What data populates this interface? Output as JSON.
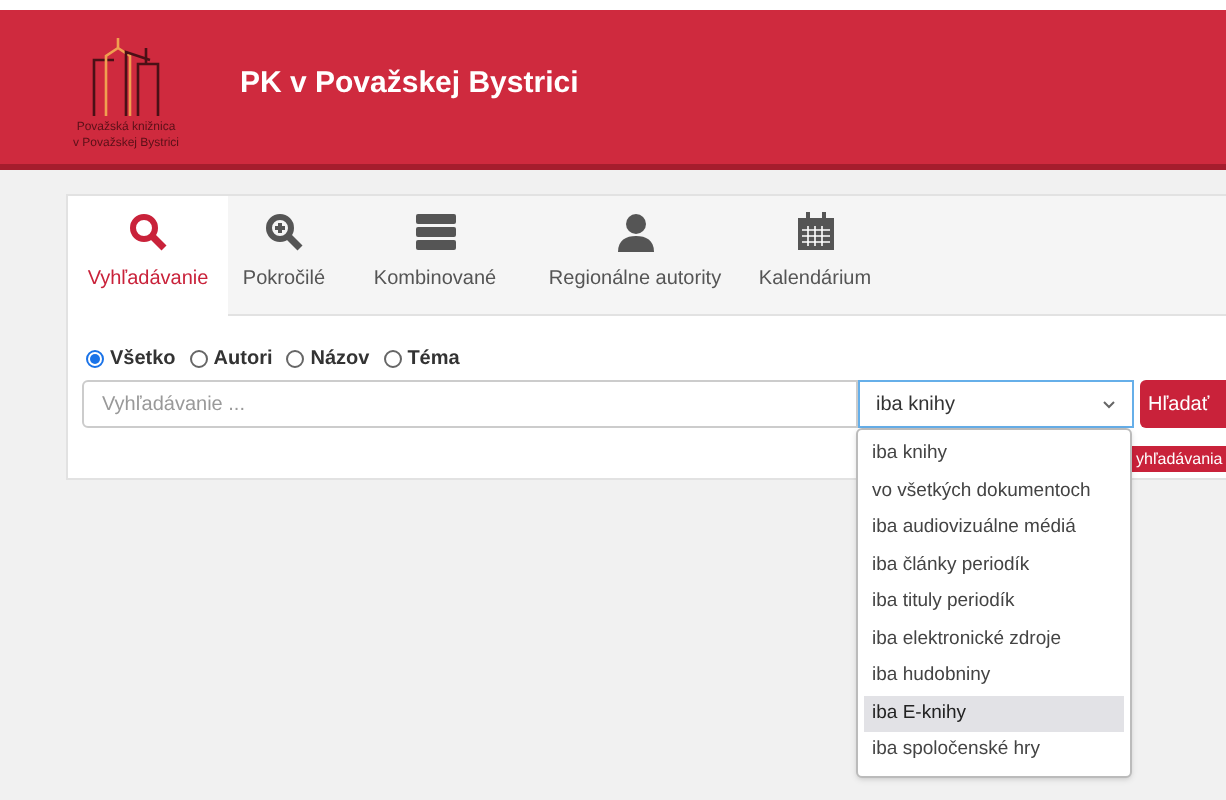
{
  "header": {
    "logo_caption": [
      "Považská knižnica",
      "v Považskej Bystrici"
    ],
    "title": "PK v Považskej Bystrici"
  },
  "tabs": [
    {
      "label": "Vyhľadávanie",
      "kind": "search",
      "selected": true
    },
    {
      "label": "Pokročilé",
      "kind": "zoom",
      "selected": false
    },
    {
      "label": "Kombinované",
      "kind": "stack",
      "selected": false
    },
    {
      "label": "Regionálne autority",
      "kind": "person",
      "selected": false
    },
    {
      "label": "Kalendárium",
      "kind": "calendar",
      "selected": false
    }
  ],
  "scopes": [
    {
      "label": "Všetko",
      "selected": true
    },
    {
      "label": "Autori",
      "selected": false
    },
    {
      "label": "Názov",
      "selected": false
    },
    {
      "label": "Téma",
      "selected": false
    }
  ],
  "search": {
    "placeholder": "Vyhľadávanie ...",
    "filter": "iba knihy",
    "button": "Hľadať"
  },
  "history_button": "yhľadávania",
  "dropdown": [
    {
      "label": "iba knihy",
      "selected": false
    },
    {
      "label": "vo všetkých dokumentoch",
      "selected": false
    },
    {
      "label": "iba audiovizuálne médiá",
      "selected": false
    },
    {
      "label": "iba články periodík",
      "selected": false
    },
    {
      "label": "iba tituly periodík",
      "selected": false
    },
    {
      "label": "iba elektronické zdroje",
      "selected": false
    },
    {
      "label": "iba hudobniny",
      "selected": false
    },
    {
      "label": "iba E-knihy",
      "selected": true
    },
    {
      "label": "iba spoločenské hry",
      "selected": false
    }
  ]
}
